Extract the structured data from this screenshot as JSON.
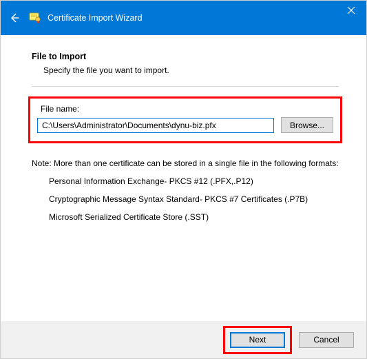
{
  "titlebar": {
    "title": "Certificate Import Wizard"
  },
  "main": {
    "heading": "File to Import",
    "sub": "Specify the file you want to import.",
    "file_label": "File name:",
    "file_value": "C:\\Users\\Administrator\\Documents\\dynu-biz.pfx",
    "browse_label": "Browse...",
    "note_intro": "Note:  More than one certificate can be stored in a single file in the following formats:",
    "fmt1": "Personal Information Exchange- PKCS #12 (.PFX,.P12)",
    "fmt2": "Cryptographic Message Syntax Standard- PKCS #7 Certificates (.P7B)",
    "fmt3": "Microsoft Serialized Certificate Store (.SST)"
  },
  "footer": {
    "next_label": "Next",
    "cancel_label": "Cancel"
  }
}
